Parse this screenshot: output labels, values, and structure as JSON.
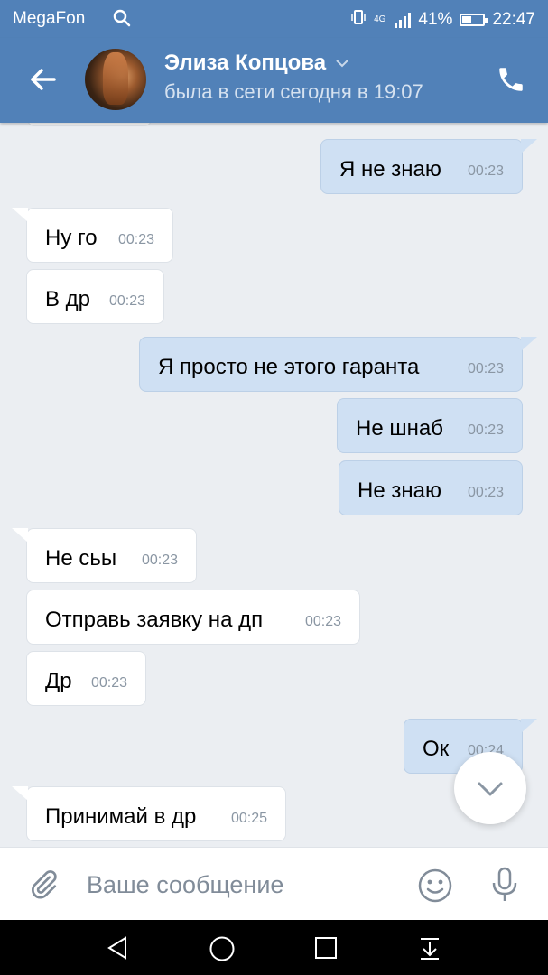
{
  "status_bar": {
    "carrier": "MegaFon",
    "network": "4G",
    "battery": "41%",
    "battery_level": 0.41,
    "time": "22:47"
  },
  "header": {
    "contact_name": "Элиза Копцова",
    "last_seen": "была в сети сегодня в 19:07"
  },
  "messages": [
    {
      "text": "Я не знаю",
      "time": "00:23",
      "direction": "outgoing"
    },
    {
      "text": "Ну го",
      "time": "00:23",
      "direction": "incoming"
    },
    {
      "text": "В др",
      "time": "00:23",
      "direction": "incoming"
    },
    {
      "text": "Я просто не этого гаранта",
      "time": "00:23",
      "direction": "outgoing"
    },
    {
      "text": "Не шнаб",
      "time": "00:23",
      "direction": "outgoing"
    },
    {
      "text": "Не знаю",
      "time": "00:23",
      "direction": "outgoing"
    },
    {
      "text": "Не сьы",
      "time": "00:23",
      "direction": "incoming"
    },
    {
      "text": "Отправь заявку на дп",
      "time": "00:23",
      "direction": "incoming"
    },
    {
      "text": "Др",
      "time": "00:23",
      "direction": "incoming"
    },
    {
      "text": "Ок",
      "time": "00:24",
      "direction": "outgoing"
    },
    {
      "text": "Принимай в др",
      "time": "00:25",
      "direction": "incoming"
    }
  ],
  "composer": {
    "placeholder": "Ваше сообщение"
  },
  "colors": {
    "header": "#5181b8",
    "chat_background": "#ebeef2",
    "outgoing_bubble": "#cfe0f3",
    "incoming_bubble": "#ffffff"
  }
}
